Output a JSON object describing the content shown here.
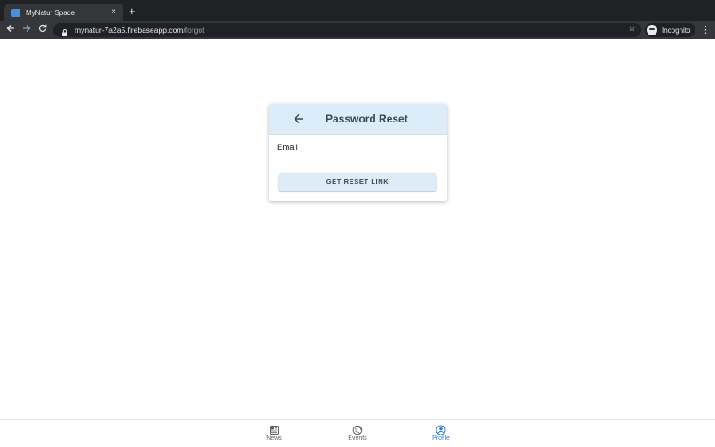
{
  "browser": {
    "tab_title": "MyNatur Space",
    "tab_close": "×",
    "new_tab": "+",
    "url_host": "mynatur-7a2a5.firebaseapp.com",
    "url_path": "/forgot",
    "profile_label": "Incognito",
    "icons": {
      "back": "arrow-left-icon",
      "forward": "arrow-right-icon",
      "reload": "reload-icon",
      "lock": "lock-icon",
      "star": "star-icon",
      "menu": "menu-dots-icon"
    }
  },
  "card": {
    "title": "Password Reset",
    "email_placeholder": "Email",
    "email_value": "",
    "reset_button_label": "GET RESET LINK"
  },
  "bottom_nav": {
    "items": [
      {
        "label": "News",
        "icon": "newspaper-icon",
        "active": false
      },
      {
        "label": "Events",
        "icon": "globe-icon",
        "active": false
      },
      {
        "label": "Profile",
        "icon": "profile-icon",
        "active": true
      }
    ]
  },
  "colors": {
    "accent": "#2f7fd8",
    "card_header_bg": "#dcedf9",
    "chrome_dark": "#202124",
    "chrome_toolbar": "#35363a"
  }
}
